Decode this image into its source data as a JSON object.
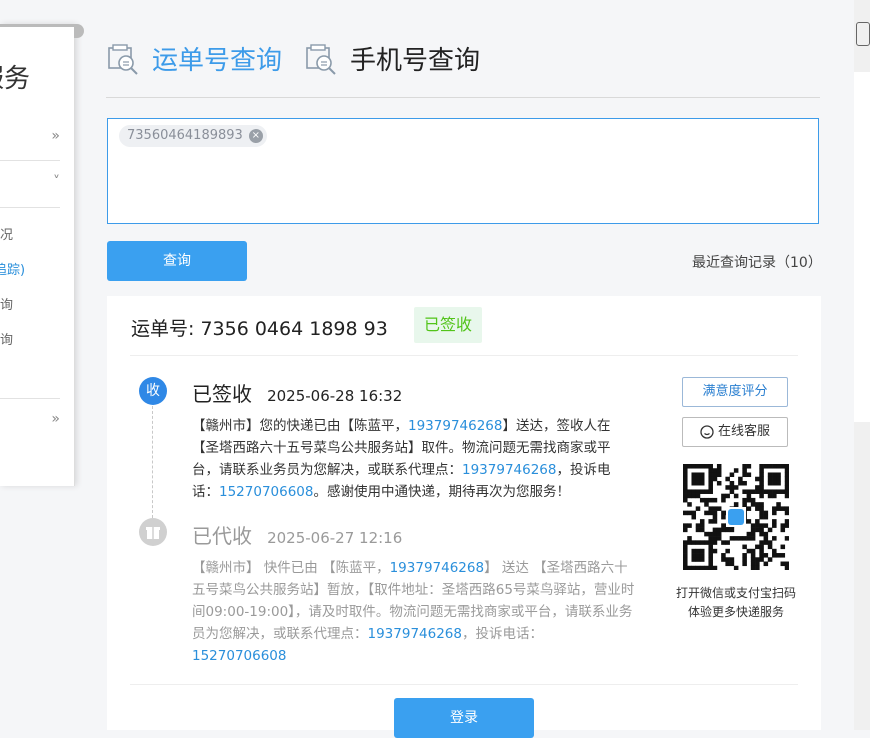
{
  "side_panel": {
    "title": "服务",
    "rows": [
      {
        "text": "»",
        "kind": "arrow"
      },
      {
        "text": "˅",
        "kind": "arrow"
      },
      {
        "text": "况",
        "kind": "text"
      },
      {
        "text": "追踪)",
        "kind": "accent"
      },
      {
        "text": "询",
        "kind": "text"
      },
      {
        "text": "询",
        "kind": "text"
      },
      {
        "text": "»",
        "kind": "arrow"
      }
    ]
  },
  "tabs": [
    {
      "label": "运单号查询",
      "active": true,
      "icon": "waybill-search-icon"
    },
    {
      "label": "手机号查询",
      "active": false,
      "icon": "phone-search-icon"
    }
  ],
  "query": {
    "chip": "73560464189893",
    "chip_close": "×",
    "button": "查询",
    "recent": "最近查询记录（10）"
  },
  "result": {
    "waybill_label": "运单号: 7356 0464 1898 93",
    "status_badge": "已签收",
    "events": [
      {
        "dot": "收",
        "status": "已签收",
        "time": "2025-06-28 16:32",
        "body_parts": [
          {
            "t": "【赣州市】您的快递已由【陈蓝平，"
          },
          {
            "t": "19379746268",
            "link": true
          },
          {
            "t": "】送达，签收人在【圣塔西路六十五号菜鸟公共服务站】取件。物流问题无需找商家或平台，请联系业务员为您解决，或联系代理点："
          },
          {
            "t": "19379746268",
            "link": true
          },
          {
            "t": "，投诉电话："
          },
          {
            "t": "15270706608",
            "link": true
          },
          {
            "t": "。感谢使用中通快递，期待再次为您服务！"
          }
        ]
      },
      {
        "dot": "",
        "status": "已代收",
        "time": "2025-06-27 12:16",
        "body_parts": [
          {
            "t": "【赣州市】 快件已由 【陈蓝平，"
          },
          {
            "t": "19379746268",
            "link": true
          },
          {
            "t": "】 送达 【圣塔西路六十五号菜鸟公共服务站】暂放，【取件地址：圣塔西路65号菜鸟驿站，营业时间09:00-19:00】，请及时取件。物流问题无需找商家或平台，请联系业务员为您解决，或联系代理点："
          },
          {
            "t": "19379746268",
            "link": true
          },
          {
            "t": "，投诉电话："
          },
          {
            "t": "15270706608",
            "link": true
          }
        ]
      }
    ],
    "rate_button": "满意度评分",
    "cs_button": "在线客服",
    "qr_caption_1": "打开微信或支付宝扫码",
    "qr_caption_2": "体验更多快递服务",
    "login_button": "登录"
  },
  "colors": {
    "accent": "#3d9be9",
    "button": "#3aa0f0",
    "link": "#2a8fdb",
    "success": "#52c41a"
  }
}
